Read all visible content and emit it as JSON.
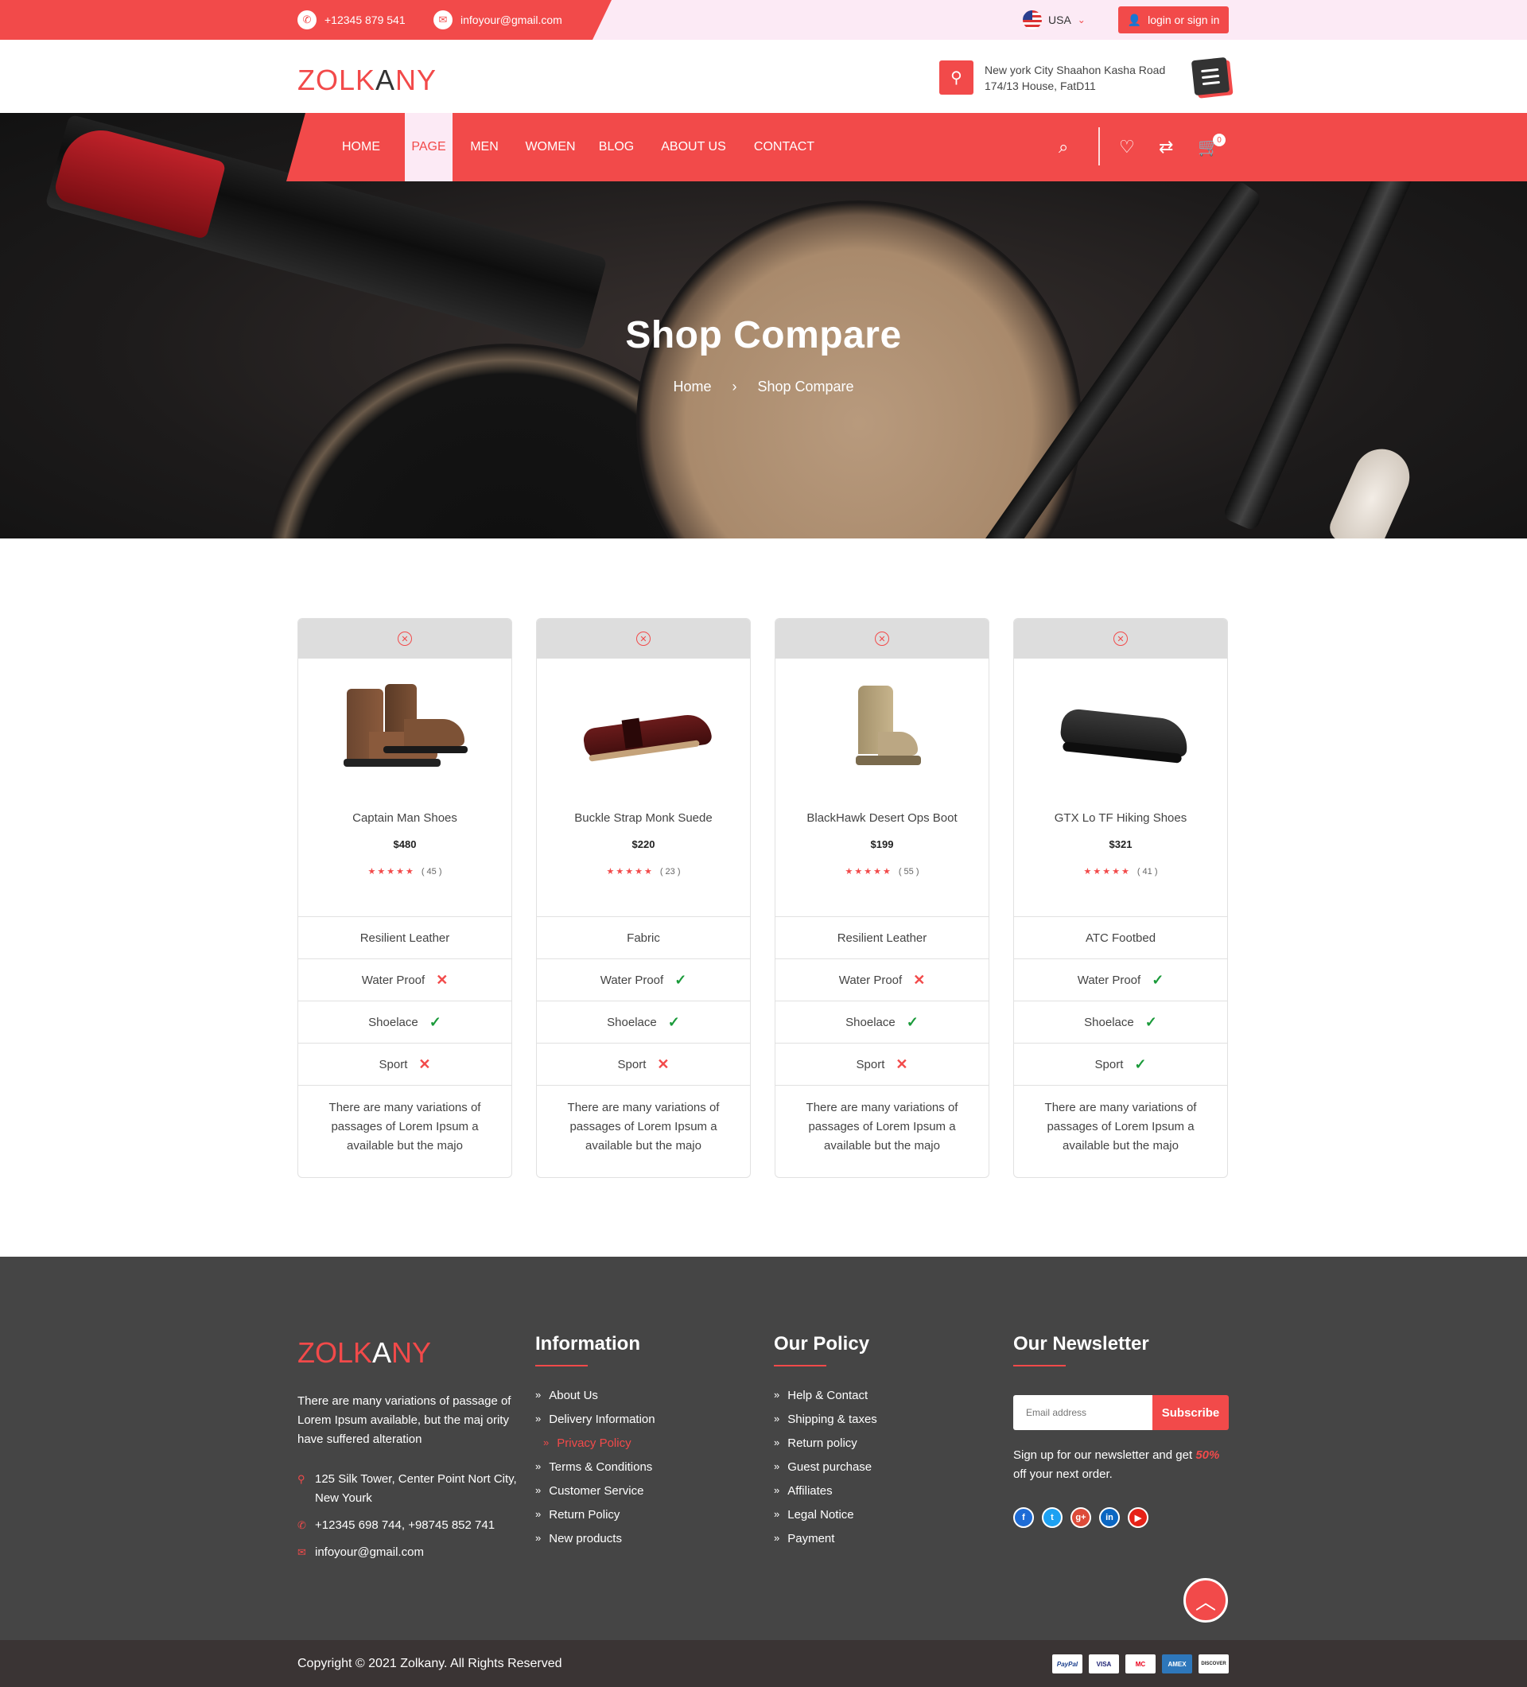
{
  "topbar": {
    "phone": "+12345 879 541",
    "email": "infoyour@gmail.com",
    "language": "USA",
    "login_label": "login or sign in"
  },
  "header": {
    "logo_part1": "ZOLK",
    "logo_part2": "A",
    "logo_part3": "NY",
    "address_line1": "New york City Shaahon Kasha Road",
    "address_line2": "174/13 House, FatD11"
  },
  "nav": {
    "items": [
      "HOME",
      "PAGE",
      "MEN",
      "WOMEN",
      "BLOG",
      "ABOUT US",
      "CONTACT"
    ],
    "active": "PAGE",
    "cart_count": "0"
  },
  "hero": {
    "title": "Shop Compare",
    "breadcrumb_home": "Home",
    "breadcrumb_sep": "›",
    "breadcrumb_current": "Shop Compare"
  },
  "products": [
    {
      "name": "Captain Man Shoes",
      "price": "$480",
      "stars": "★★★★★",
      "reviews": "( 45 )",
      "material": "Resilient Leather",
      "water_proof": "Water Proof",
      "water_proof_ok": false,
      "shoelace": "Shoelace",
      "shoelace_ok": true,
      "sport": "Sport",
      "sport_ok": false,
      "description": "There are many variations of passages of Lorem Ipsum a available but the majo"
    },
    {
      "name": "Buckle Strap Monk Suede",
      "price": "$220",
      "stars": "★★★★★",
      "reviews": "( 23 )",
      "material": "Fabric",
      "water_proof": "Water Proof",
      "water_proof_ok": true,
      "shoelace": "Shoelace",
      "shoelace_ok": true,
      "sport": "Sport",
      "sport_ok": false,
      "description": "There are many variations of passages of Lorem Ipsum a available but the majo"
    },
    {
      "name": "BlackHawk Desert Ops Boot",
      "price": "$199",
      "stars": "★★★★★",
      "reviews": "( 55 )",
      "material": "Resilient Leather",
      "water_proof": "Water Proof",
      "water_proof_ok": false,
      "shoelace": "Shoelace",
      "shoelace_ok": true,
      "sport": "Sport",
      "sport_ok": false,
      "description": "There are many variations of passages of Lorem Ipsum a available but the majo"
    },
    {
      "name": "GTX Lo TF Hiking Shoes",
      "price": "$321",
      "stars": "★★★★★",
      "reviews": "( 41 )",
      "material": "ATC Footbed",
      "water_proof": "Water Proof",
      "water_proof_ok": true,
      "shoelace": "Shoelace",
      "shoelace_ok": true,
      "sport": "Sport",
      "sport_ok": true,
      "description": "There are many variations of passages of Lorem Ipsum a available but the majo"
    }
  ],
  "footer": {
    "about": "There are many variations of passage of Lorem Ipsum available, but the maj ority have suffered alteration",
    "address": "125 Silk Tower, Center Point Nort City, New Yourk",
    "phones": "+12345 698 744, +98745 852 741",
    "email": "infoyour@gmail.com",
    "information_title": "Information",
    "information_links": [
      "About Us",
      "Delivery Information",
      "Privacy Policy",
      "Terms & Conditions",
      "Customer Service",
      "Return Policy",
      "New products"
    ],
    "policy_title": "Our Policy",
    "policy_links": [
      "Help & Contact",
      "Shipping & taxes",
      "Return policy",
      "Guest purchase",
      "Affiliates",
      "Legal Notice",
      "Payment"
    ],
    "newsletter_title": "Our Newsletter",
    "email_placeholder": "Email address",
    "subscribe_label": "Subscribe",
    "newsletter_text_before": "Sign up for our newsletter and get ",
    "newsletter_discount": "50%",
    "newsletter_text_after": " off your next order.",
    "socials": [
      "f",
      "t",
      "g+",
      "in",
      "▶"
    ],
    "copyright": "Copyright © 2021 Zolkany. All Rights Reserved",
    "payment_methods": [
      "PayPal",
      "VISA",
      "MC",
      "AMEX",
      "DISCOVER"
    ]
  },
  "colors": {
    "accent": "#f24a4a",
    "topbar_bg": "#fceaf5",
    "footer_bg": "#454545",
    "bottombar_bg": "#3a3434",
    "check": "#1a9a3a"
  }
}
